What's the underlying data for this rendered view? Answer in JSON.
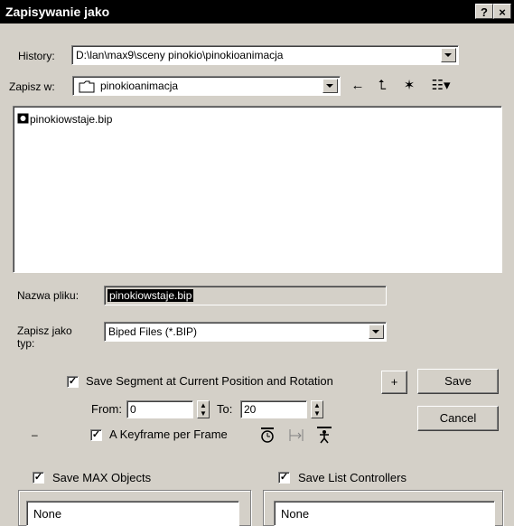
{
  "window": {
    "title": "Zapisywanie jako",
    "help": "?",
    "close": "×"
  },
  "history": {
    "label": "History:",
    "value": "D:\\lan\\max9\\sceny pinokio\\pinokioanimacja"
  },
  "save_in": {
    "label": "Zapisz w:",
    "value": "pinokioanimacja"
  },
  "toolbar": {
    "back": "←",
    "up": "⮤",
    "new_folder": "✶",
    "view": "☷▾"
  },
  "files": [
    {
      "name": "pinokiowstaje.bip"
    }
  ],
  "filename": {
    "label": "Nazwa pliku:",
    "value": "pinokiowstaje.bip"
  },
  "filetype": {
    "label": "Zapisz jako typ:",
    "value": "Biped Files (*.BIP)"
  },
  "options": {
    "save_segment": {
      "label": "Save Segment at Current Position and Rotation",
      "checked": "✓"
    },
    "plus_label": "+",
    "from_label": "From:",
    "from_value": "0",
    "to_label": "To:",
    "to_value": "20",
    "keyframe": {
      "label": "A Keyframe per Frame",
      "checked": "✓"
    },
    "dash": "–",
    "spin_up": "▲",
    "spin_down": "▼"
  },
  "buttons": {
    "save": "Save",
    "cancel": "Cancel"
  },
  "max_objects": {
    "label": "Save MAX Objects",
    "checked": "✓",
    "list_value": "None"
  },
  "list_controllers": {
    "label": "Save List Controllers",
    "checked": "✓",
    "list_value": "None"
  }
}
